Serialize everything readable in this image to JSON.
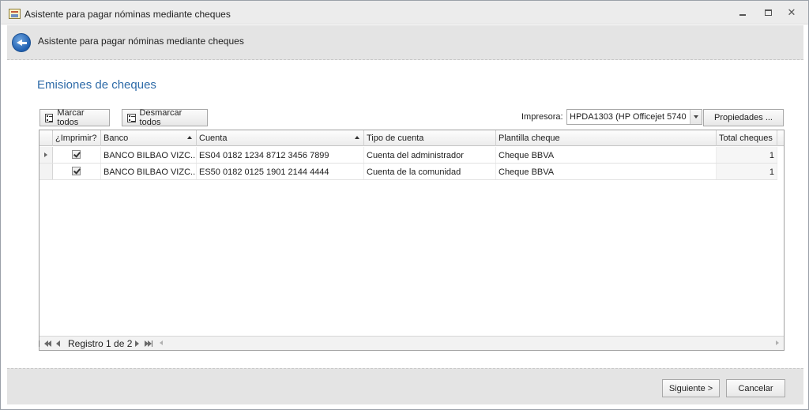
{
  "window": {
    "title": "Asistente para pagar nóminas mediante cheques"
  },
  "header": {
    "title": "Asistente para pagar nóminas mediante cheques"
  },
  "section": {
    "title": "Emisiones de cheques"
  },
  "toolbar": {
    "mark_all": "Marcar todos",
    "unmark_all": "Desmarcar todos",
    "printer_label": "Impresora:",
    "printer_value": "HPDA1303 (HP Officejet 5740 s",
    "properties": "Propiedades ..."
  },
  "grid": {
    "columns": [
      "¿Imprimir?",
      "Banco",
      "Cuenta",
      "Tipo de cuenta",
      "Plantilla cheque",
      "Total cheques"
    ],
    "rows": [
      {
        "print": true,
        "bank": "BANCO BILBAO VIZC...",
        "account": "ES04 0182 1234 8712 3456 7899",
        "type": "Cuenta del administrador",
        "template": "Cheque BBVA",
        "total": "1"
      },
      {
        "print": true,
        "bank": "BANCO BILBAO VIZC...",
        "account": "ES50 0182 0125 1901 2144 4444",
        "type": "Cuenta de la comunidad",
        "template": "Cheque BBVA",
        "total": "1"
      }
    ],
    "navigator": {
      "text": "Registro 1 de 2"
    }
  },
  "footer": {
    "next_label": "Siguiente >",
    "cancel_label": "Cancelar"
  }
}
